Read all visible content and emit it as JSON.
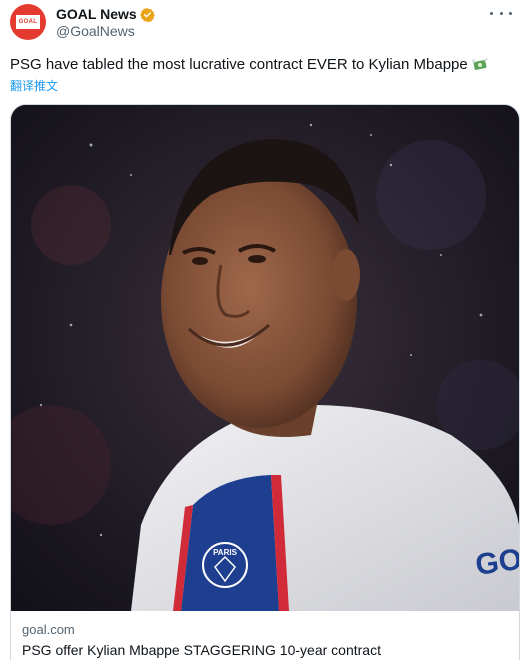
{
  "author": {
    "display_name": "GOAL News",
    "handle": "@GoalNews",
    "avatar_text": "GOAL",
    "verified": true,
    "avatar_color": "#e43a2f"
  },
  "tweet": {
    "text": "PSG have tabled the most lucrative contract EVER to Kylian Mbappe",
    "emoji": "money-with-wings-icon",
    "translate_label": "翻译推文"
  },
  "card": {
    "source": "goal.com",
    "title": "PSG offer Kylian Mbappe STAGGERING 10-year contract",
    "image_description_icon": "player-photo",
    "jersey_badge_text": "PARIS",
    "jersey_sleeve_text": "GO"
  },
  "colors": {
    "text_primary": "#0f1419",
    "text_secondary": "#536471",
    "link": "#1d9bf0",
    "border": "#cfd9de"
  },
  "icons": {
    "verified": "verified-badge-icon",
    "more": "more-options-icon"
  }
}
